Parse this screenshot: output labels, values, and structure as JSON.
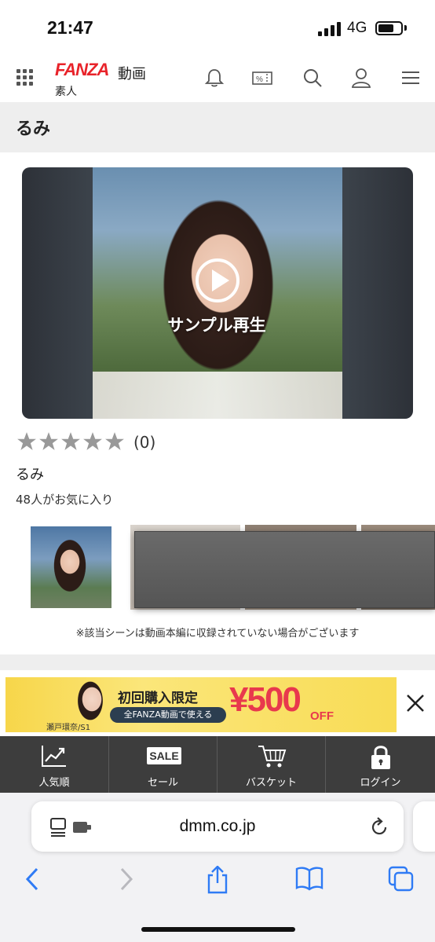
{
  "status_bar": {
    "time": "21:47",
    "network": "4G"
  },
  "header": {
    "logo_text": "FANZA",
    "logo_subtitle": "動画",
    "category": "素人",
    "icons": [
      "grid-menu-icon",
      "bell-icon",
      "coupon-icon",
      "search-icon",
      "user-icon",
      "hamburger-menu-icon"
    ]
  },
  "page": {
    "title": "るみ"
  },
  "player": {
    "play_label": "サンプル再生"
  },
  "rating": {
    "stars": 0,
    "max_stars": 5,
    "review_count": "(0)"
  },
  "product": {
    "actress": "るみ",
    "favorites": "48人がお気に入り"
  },
  "scene_note": "※該当シーンは動画本編に収録されていない場合がございます",
  "banner": {
    "title": "初回購入限定",
    "pill": "全FANZA動画で使える",
    "price": "¥500",
    "off": "OFF",
    "caption": "瀬戸環奈/S1"
  },
  "bottom_nav": [
    {
      "label": "人気順",
      "icon": "trending-chart-icon"
    },
    {
      "label": "セール",
      "icon": "sale-tag-icon",
      "badge": "SALE"
    },
    {
      "label": "バスケット",
      "icon": "cart-icon"
    },
    {
      "label": "ログイン",
      "icon": "lock-icon"
    }
  ],
  "browser": {
    "url": "dmm.co.jp"
  },
  "colors": {
    "brand_red": "#e8232a",
    "nav_bg": "#3d3d3d",
    "banner_yellow": "#f7d64a",
    "price_red": "#e8394d"
  }
}
